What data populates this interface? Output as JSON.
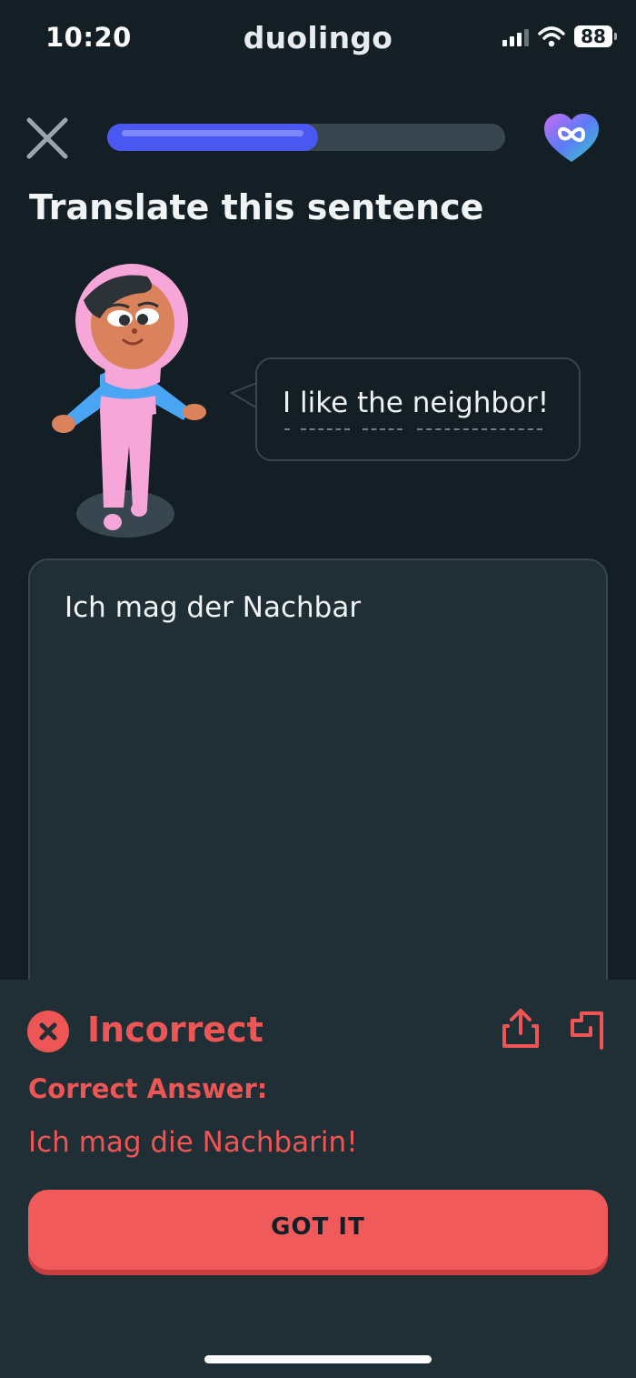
{
  "status_bar": {
    "time": "10:20",
    "app_name": "duolingo",
    "battery_level": "88",
    "icons": [
      "cellular-signal-icon",
      "wifi-icon",
      "battery-icon"
    ]
  },
  "lesson": {
    "progress_fraction": 0.53,
    "instruction": "Translate this sentence",
    "prompt": {
      "words": [
        "I",
        "like",
        "the",
        "neighbor!"
      ],
      "text": "I like the neighbor!"
    },
    "user_answer": "Ich mag der Nachbar",
    "icons": [
      "close-icon",
      "infinite-hearts-icon"
    ]
  },
  "feedback": {
    "status": "Incorrect",
    "correct_label": "Correct Answer:",
    "correct_answer": "Ich mag die Nachbarin!",
    "button_label": "GOT IT",
    "icons": [
      "incorrect-x-icon",
      "share-icon",
      "report-flag-icon"
    ]
  },
  "colors": {
    "background": "#131f24",
    "surface": "#202f36",
    "border": "#37464f",
    "progress": "#4a57f0",
    "error": "#ee5555",
    "button": "#f05a5a",
    "text": "#f1f4f5"
  }
}
